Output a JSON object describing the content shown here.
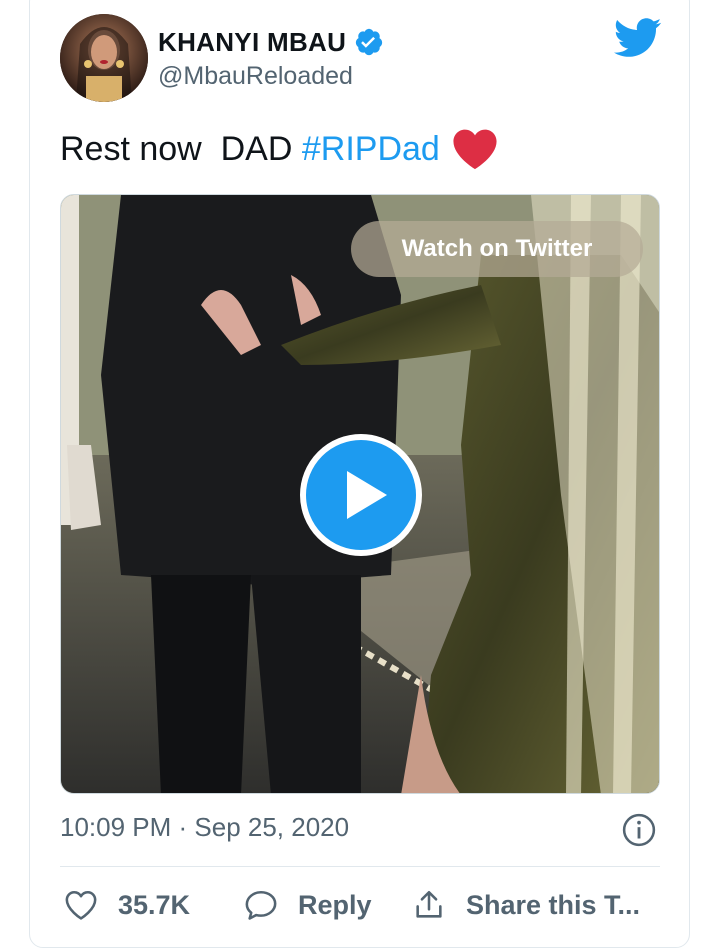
{
  "author": {
    "display_name": "KHANYI MBAU",
    "handle": "@MbauReloaded",
    "verified": true
  },
  "tweet": {
    "text_main": "Rest now  DAD ",
    "hashtag": "#RIPDad",
    "emoji": "red-heart",
    "timestamp": "10:09 PM · Sep 25, 2020"
  },
  "media": {
    "watch_label": "Watch on Twitter",
    "type": "video"
  },
  "actions": {
    "like_count": "35.7K",
    "reply_label": "Reply",
    "share_label": "Share this T..."
  },
  "colors": {
    "twitter_blue": "#1d9bf0",
    "heart_red": "#e0245e",
    "muted_text": "#536471"
  }
}
